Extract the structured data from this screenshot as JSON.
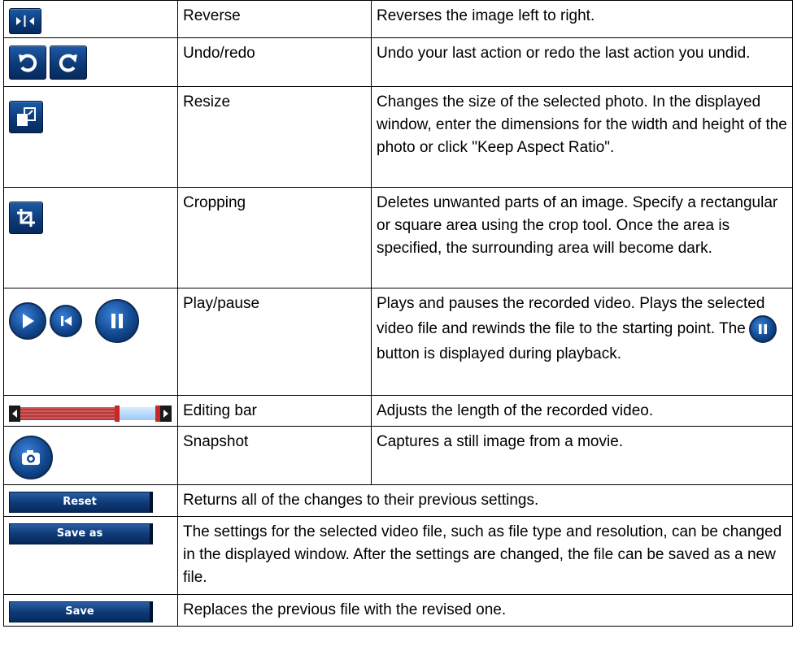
{
  "rows": [
    {
      "name": "Reverse",
      "icons": [
        "reverse-icon"
      ],
      "description": "Reverses the image left to right."
    },
    {
      "name": "Undo/redo",
      "icons": [
        "undo-icon",
        "redo-icon"
      ],
      "description": "Undo your last action or redo the last action you undid."
    },
    {
      "name": "Resize",
      "icons": [
        "resize-icon"
      ],
      "description": "Changes the size of the selected photo. In the displayed window, enter the dimensions for the width and height of the photo or click \"Keep Aspect Ratio\"."
    },
    {
      "name": "Cropping",
      "icons": [
        "crop-icon"
      ],
      "description": "Deletes unwanted parts of an image. Specify a rectangular or square area using the crop tool. Once the area is specified, the surrounding area will become dark."
    },
    {
      "name": "Play/pause",
      "icons": [
        "play-icon",
        "rewind-icon",
        "pause-icon"
      ],
      "description_before": "Plays and pauses the recorded video. Plays the selected video file and rewinds the file to the starting point. The",
      "description_after": "button is displayed during playback."
    },
    {
      "name": "Editing bar",
      "icons": [
        "editing-bar-icon"
      ],
      "description": "Adjusts the length of the recorded video."
    },
    {
      "name": "Snapshot",
      "icons": [
        "camera-icon"
      ],
      "description": "Captures a still image from a movie."
    }
  ],
  "buttons": [
    {
      "label": "Reset",
      "description": "Returns all of the changes to their previous settings."
    },
    {
      "label": "Save as",
      "description": "The settings for the selected video file, such as file type and resolution, can be changed in the displayed window. After the settings are changed, the file can be saved as a new file."
    },
    {
      "label": "Save",
      "description": "Replaces the previous file with the revised one."
    }
  ],
  "colors": {
    "icon_blue": "#0c3a78",
    "editing_red": "#c62828",
    "editing_blue": "#9cc9f4"
  }
}
